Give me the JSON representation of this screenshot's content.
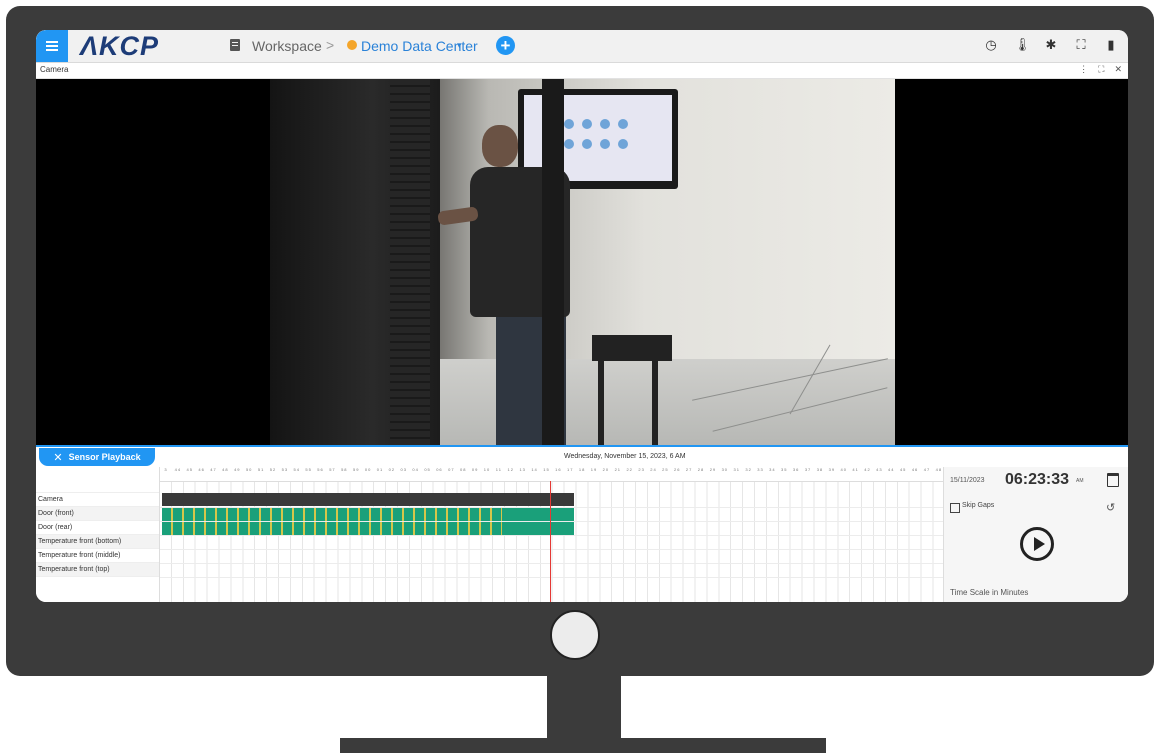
{
  "app": {
    "logo": "ΛKCP",
    "breadcrumb": {
      "workspace": "Workspace",
      "separator": ">",
      "location": "Demo Data Center",
      "caret": "▾"
    },
    "add_label": "+",
    "top_icons": [
      "clock-icon",
      "thermometer-icon",
      "bug-icon",
      "fullscreen-icon",
      "user-icon"
    ]
  },
  "camera_panel": {
    "title": "Camera",
    "controls": [
      "⋮",
      "⛶",
      "✕"
    ]
  },
  "playback": {
    "tab_label": "Sensor Playback",
    "close_glyph": "✕",
    "date_header": "Wednesday, November 15, 2023, 6 AM",
    "minute_ticks": [
      "3",
      "44",
      "45",
      "46",
      "47",
      "48",
      "49",
      "50",
      "51",
      "52",
      "53",
      "54",
      "55",
      "56",
      "57",
      "58",
      "59",
      "00",
      "01",
      "02",
      "03",
      "04",
      "05",
      "06",
      "07",
      "08",
      "09",
      "10",
      "11",
      "12",
      "13",
      "14",
      "15",
      "16",
      "17",
      "18",
      "19",
      "20",
      "21",
      "22",
      "23",
      "24",
      "25",
      "26",
      "27",
      "28",
      "29",
      "30",
      "31",
      "32",
      "33",
      "34",
      "35",
      "36",
      "37",
      "38",
      "39",
      "40",
      "41",
      "42",
      "43",
      "44",
      "45",
      "46",
      "47",
      "48",
      "49",
      "50",
      "51",
      "52",
      "53",
      "54",
      "55",
      "56",
      "57",
      "58",
      "59",
      "00",
      "01",
      "02",
      "03",
      "04",
      "05",
      "06",
      "07",
      "08",
      "09",
      "10",
      "11",
      "12",
      "13",
      "14",
      "15",
      "16",
      "17",
      "18",
      "19",
      "20",
      "21",
      "22",
      "23",
      "24",
      "25",
      "26",
      "27",
      "28",
      "29",
      "30",
      "31",
      "32",
      "3"
    ],
    "rows": [
      {
        "label": "Camera"
      },
      {
        "label": "Door (front)"
      },
      {
        "label": "Door (rear)"
      },
      {
        "label": "Temperature front (bottom)"
      },
      {
        "label": "Temperature front (middle)"
      },
      {
        "label": "Temperature front (top)"
      }
    ],
    "right_panel": {
      "date": "15/11/2023",
      "time": "06:23:33",
      "ampm": "AM",
      "skip_gaps_label": "Skip Gaps",
      "time_scale_label": "Time Scale in Minutes"
    }
  },
  "colors": {
    "accent": "#2196f3",
    "logo": "#1d3c78",
    "location_dot": "#f4a52a",
    "door_bar": "#1aa07a",
    "door_marker": "#d6c64a",
    "camera_bar": "#3a3a3a",
    "cursor": "#e53935"
  }
}
